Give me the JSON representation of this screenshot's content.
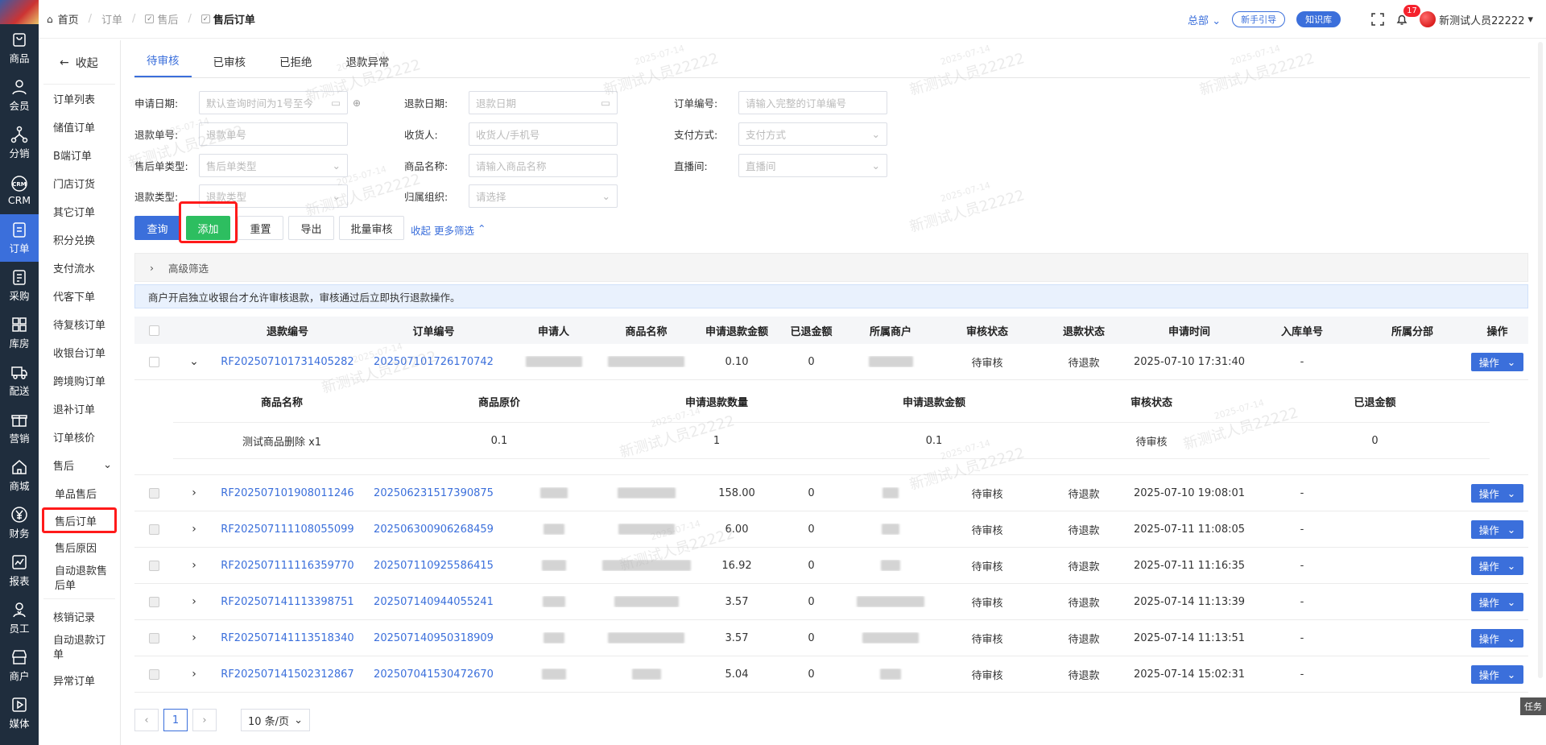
{
  "rail": [
    {
      "label": "商品",
      "icon": "bag-icon"
    },
    {
      "label": "会员",
      "icon": "user-icon"
    },
    {
      "label": "分销",
      "icon": "network-icon"
    },
    {
      "label": "CRM",
      "icon": "crm-icon"
    },
    {
      "label": "订单",
      "icon": "order-icon",
      "active": true
    },
    {
      "label": "采购",
      "icon": "purchase-icon"
    },
    {
      "label": "库房",
      "icon": "warehouse-icon"
    },
    {
      "label": "配送",
      "icon": "truck-icon"
    },
    {
      "label": "营销",
      "icon": "gift-icon"
    },
    {
      "label": "商城",
      "icon": "home-icon"
    },
    {
      "label": "财务",
      "icon": "yen-icon"
    },
    {
      "label": "报表",
      "icon": "chart-icon"
    },
    {
      "label": "员工",
      "icon": "staff-icon"
    },
    {
      "label": "商户",
      "icon": "shop-icon"
    },
    {
      "label": "媒体",
      "icon": "media-icon"
    }
  ],
  "sidebar": {
    "collapse_label": "收起",
    "items": [
      "订单列表",
      "储值订单",
      "B端订单",
      "门店订货",
      "其它订单",
      "积分兑换",
      "支付流水",
      "代客下单",
      "待复核订单",
      "收银台订单",
      "跨境购订单",
      "退补订单",
      "订单核价"
    ],
    "group_label": "售后",
    "sub_items": [
      "单品售后",
      "售后订单",
      "售后原因",
      "自动退款售后单"
    ],
    "bottom_items": [
      "核销记录",
      "自动退款订单",
      "异常订单"
    ]
  },
  "breadcrumb": {
    "home": "首页",
    "orders": "订单",
    "aftersale": "售后",
    "current": "售后订单"
  },
  "topbar": {
    "hq": "总部",
    "guide": "新手引导",
    "kb": "知识库",
    "notify_count": "17",
    "user": "新测试人员22222"
  },
  "tabs": [
    "待审核",
    "已审核",
    "已拒绝",
    "退款异常"
  ],
  "filters": {
    "apply_date": {
      "label": "申请日期:",
      "placeholder": "默认查询时间为1号至今"
    },
    "refund_date": {
      "label": "退款日期:",
      "placeholder": "退款日期"
    },
    "order_no": {
      "label": "订单编号:",
      "placeholder": "请输入完整的订单编号"
    },
    "refund_no": {
      "label": "退款单号:",
      "placeholder": "退款单号"
    },
    "receiver": {
      "label": "收货人:",
      "placeholder": "收货人/手机号"
    },
    "pay_method": {
      "label": "支付方式:",
      "placeholder": "支付方式"
    },
    "after_type": {
      "label": "售后单类型:",
      "placeholder": "售后单类型"
    },
    "goods_name": {
      "label": "商品名称:",
      "placeholder": "请输入商品名称"
    },
    "live": {
      "label": "直播间:",
      "placeholder": "直播间"
    },
    "refund_type": {
      "label": "退款类型:",
      "placeholder": "退款类型"
    },
    "org": {
      "label": "归属组织:",
      "placeholder": "请选择"
    }
  },
  "actions": {
    "query": "查询",
    "add": "添加",
    "reset": "重置",
    "export": "导出",
    "batch": "批量审核",
    "collapse": "收起",
    "more": "更多筛选"
  },
  "advanced": "高级筛选",
  "notice": "商户开启独立收银台才允许审核退款，审核通过后立即执行退款操作。",
  "columns": [
    "退款编号",
    "订单编号",
    "申请人",
    "商品名称",
    "申请退款金额",
    "已退金额",
    "所属商户",
    "审核状态",
    "退款状态",
    "申请时间",
    "入库单号",
    "所属分部",
    "操作"
  ],
  "rows": [
    {
      "refund_no": "RF202507101731405282",
      "order_no": "202507101726170742",
      "amount": "0.10",
      "refunded": "0",
      "audit": "待审核",
      "refund_status": "待退款",
      "time": "2025-07-10 17:31:40",
      "stock_no": "-",
      "op": "操作"
    },
    {
      "refund_no": "RF202507101908011246",
      "order_no": "202506231517390875",
      "amount": "158.00",
      "refunded": "0",
      "audit": "待审核",
      "refund_status": "待退款",
      "time": "2025-07-10 19:08:01",
      "stock_no": "-",
      "op": "操作"
    },
    {
      "refund_no": "RF202507111108055099",
      "order_no": "202506300906268459",
      "amount": "6.00",
      "refunded": "0",
      "audit": "待审核",
      "refund_status": "待退款",
      "time": "2025-07-11 11:08:05",
      "stock_no": "-",
      "op": "操作"
    },
    {
      "refund_no": "RF202507111116359770",
      "order_no": "202507110925586415",
      "amount": "16.92",
      "refunded": "0",
      "audit": "待审核",
      "refund_status": "待退款",
      "time": "2025-07-11 11:16:35",
      "stock_no": "-",
      "op": "操作"
    },
    {
      "refund_no": "RF202507141113398751",
      "order_no": "202507140944055241",
      "amount": "3.57",
      "refunded": "0",
      "audit": "待审核",
      "refund_status": "待退款",
      "time": "2025-07-14 11:13:39",
      "stock_no": "-",
      "op": "操作"
    },
    {
      "refund_no": "RF202507141113518340",
      "order_no": "202507140950318909",
      "amount": "3.57",
      "refunded": "0",
      "audit": "待审核",
      "refund_status": "待退款",
      "time": "2025-07-14 11:13:51",
      "stock_no": "-",
      "op": "操作"
    },
    {
      "refund_no": "RF202507141502312867",
      "order_no": "202507041530472670",
      "amount": "5.04",
      "refunded": "0",
      "audit": "待审核",
      "refund_status": "待退款",
      "time": "2025-07-14 15:02:31",
      "stock_no": "-",
      "op": "操作"
    }
  ],
  "detail": {
    "columns": [
      "商品名称",
      "商品原价",
      "申请退款数量",
      "申请退款金额",
      "审核状态",
      "已退金额"
    ],
    "row": [
      "测试商品删除 x1",
      "0.1",
      "1",
      "0.1",
      "待审核",
      "0"
    ]
  },
  "pager": {
    "page": "1",
    "size": "10 条/页"
  },
  "watermark": "新测试人员22222",
  "watermark_date": "2025-07-14",
  "task": "任务"
}
